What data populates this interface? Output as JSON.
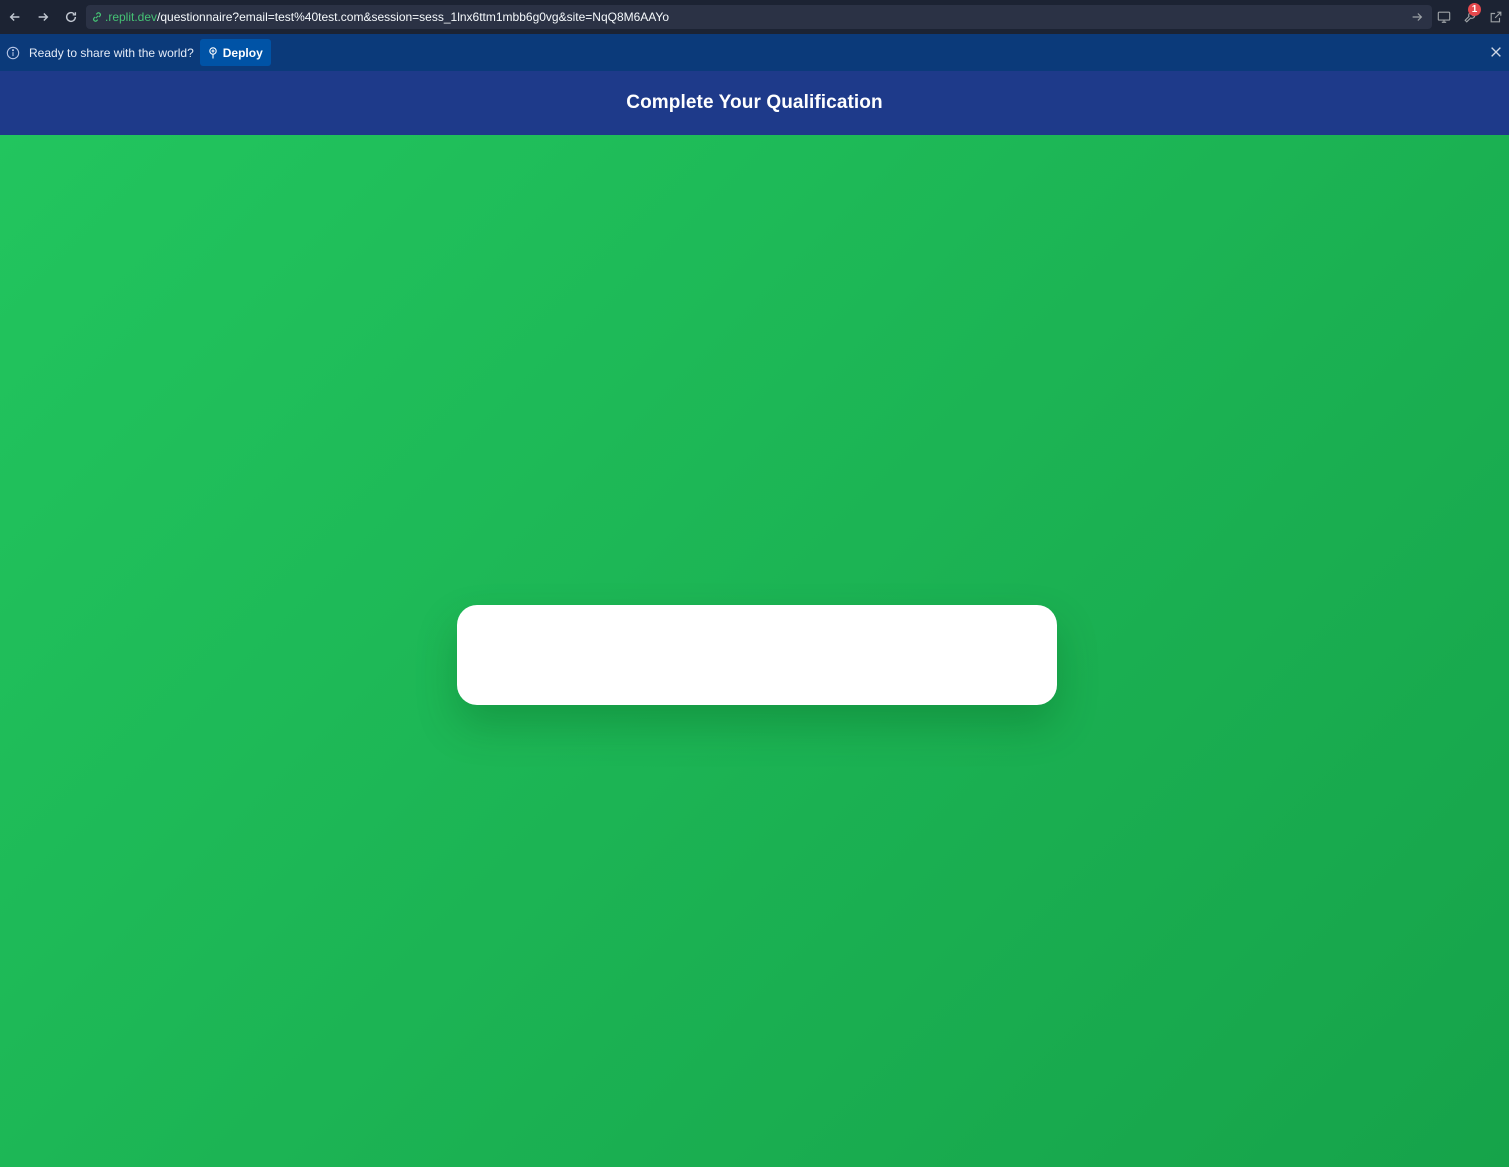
{
  "browser": {
    "url_host": ".replit.dev",
    "url_path": "/questionnaire?email=test%40test.com&session=sess_1lnx6ttm1mbb6g0vg&site=NqQ8M6AAYo",
    "notification_count": "1"
  },
  "banner": {
    "text": "Ready to share with the world?",
    "deploy_label": "Deploy"
  },
  "header": {
    "title": "Complete Your Qualification"
  },
  "colors": {
    "header_bg": "#1e3a8a",
    "main_gradient_start": "#22c55e",
    "main_gradient_end": "#16a34a",
    "banner_bg": "#0b3a7a",
    "deploy_button": "#0053a6"
  },
  "icons": [
    "back-arrow-icon",
    "forward-arrow-icon",
    "reload-icon",
    "link-icon",
    "go-arrow-icon",
    "monitor-icon",
    "wrench-icon",
    "external-link-icon",
    "info-icon",
    "deploy-icon",
    "close-icon"
  ]
}
